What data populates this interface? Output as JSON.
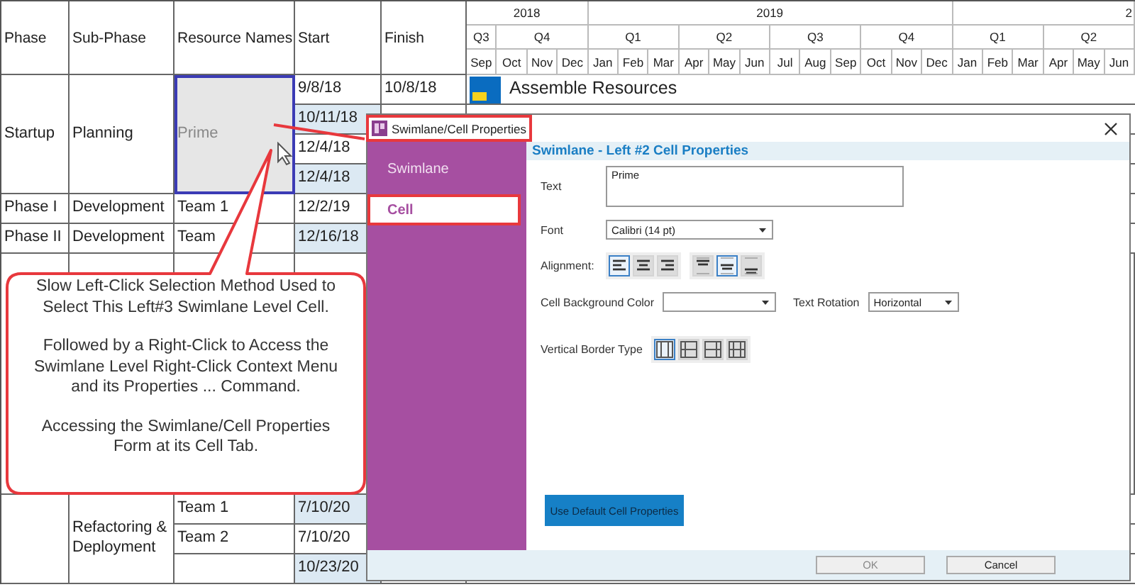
{
  "table": {
    "columns": [
      "Phase",
      "Sub-Phase",
      "Resource Names",
      "Start",
      "Finish"
    ],
    "years": [
      {
        "label": "2018",
        "quarters": [
          {
            "label": "Q3",
            "months": [
              "Sep"
            ]
          },
          {
            "label": "Q4",
            "months": [
              "Oct",
              "Nov",
              "Dec"
            ]
          }
        ]
      },
      {
        "label": "2019",
        "quarters": [
          {
            "label": "Q1",
            "months": [
              "Jan",
              "Feb",
              "Mar"
            ]
          },
          {
            "label": "Q2",
            "months": [
              "Apr",
              "May",
              "Jun"
            ]
          },
          {
            "label": "Q3",
            "months": [
              "Jul",
              "Aug",
              "Sep"
            ]
          },
          {
            "label": "Q4",
            "months": [
              "Oct",
              "Nov",
              "Dec"
            ]
          }
        ]
      },
      {
        "label": "2",
        "cut_off": true,
        "quarters": [
          {
            "label": "Q1",
            "months": [
              "Jan",
              "Feb",
              "Mar"
            ]
          },
          {
            "label": "Q2",
            "months": [
              "Apr",
              "May",
              "Jun"
            ]
          }
        ]
      }
    ],
    "groups": [
      {
        "phase": "Startup",
        "subphases": [
          {
            "name": "Planning",
            "resources": [
              {
                "name": "Prime",
                "selected": true,
                "tasks": [
                  {
                    "start": "9/8/18",
                    "finish": "10/8/18",
                    "shaded": false,
                    "bar_label": "Assemble Resources"
                  },
                  {
                    "start": "10/11/18",
                    "shaded": true
                  },
                  {
                    "start": "12/4/18",
                    "shaded": false
                  },
                  {
                    "start": "12/4/18",
                    "shaded": true
                  }
                ]
              }
            ]
          }
        ]
      },
      {
        "phase": "Phase I",
        "subphases": [
          {
            "name": "Development",
            "resources": [
              {
                "name": "Team 1",
                "selected": false,
                "tasks": [
                  {
                    "start": "12/2/19",
                    "shaded": false
                  }
                ]
              }
            ]
          }
        ]
      },
      {
        "phase": "Phase II",
        "subphases": [
          {
            "name": "Development",
            "resources": [
              {
                "name": "Team",
                "selected": false,
                "tasks": [
                  {
                    "start": "12/16/18",
                    "shaded": true
                  }
                ]
              }
            ]
          }
        ]
      },
      {
        "gap_before": true,
        "subphases": [
          {
            "name": "Refactoring & Deployment",
            "resources": [
              {
                "name": "Team 1",
                "selected": false,
                "tasks": [
                  {
                    "start": "7/10/20",
                    "shaded": true
                  }
                ]
              },
              {
                "name": "Team 2",
                "selected": false,
                "tasks": [
                  {
                    "start": "7/10/20",
                    "shaded": false
                  }
                ]
              },
              {
                "selected": false,
                "tasks": [
                  {
                    "start": "10/23/20",
                    "shaded": true
                  }
                ]
              }
            ]
          }
        ]
      }
    ]
  },
  "dialog": {
    "title": "Swimlane/Cell Properties",
    "title_highlighted": true,
    "tabs": [
      {
        "label": "Swimlane",
        "selected": false,
        "highlighted": false
      },
      {
        "label": "Cell",
        "selected": true,
        "highlighted": true
      }
    ],
    "heading": "Swimlane - Left #2 Cell Properties",
    "text_label": "Text",
    "text_value": "Prime",
    "font_label": "Font",
    "font_value": "Calibri (14 pt)",
    "alignment_label": "Alignment:",
    "horizontal_alignment": [
      {
        "kind": "left",
        "selected": true
      },
      {
        "kind": "center",
        "selected": false
      },
      {
        "kind": "right",
        "selected": false
      }
    ],
    "vertical_alignment": [
      {
        "kind": "top",
        "selected": false
      },
      {
        "kind": "middle",
        "selected": true
      },
      {
        "kind": "bottom",
        "selected": false
      }
    ],
    "background_label": "Cell Background Color",
    "rotation_label": "Text Rotation",
    "rotation_value": "Horizontal",
    "border_label": "Vertical Border Type",
    "border_types": [
      {
        "kind": "both",
        "selected": true
      },
      {
        "kind": "left",
        "selected": false
      },
      {
        "kind": "right",
        "selected": false
      },
      {
        "kind": "grid",
        "selected": false
      }
    ],
    "default_button": "Use Default Cell Properties",
    "buttons": [
      {
        "label": "OK",
        "disabled": true
      },
      {
        "label": "Cancel",
        "disabled": false
      }
    ]
  },
  "callout": {
    "paragraphs": [
      "Slow Left-Click Selection Method Used to Select This Left#3 Swimlane Level Cell.",
      "Followed by a Right-Click to Access the Swimlane Level Right-Click Context Menu and its Properties ... Command.",
      "Accessing the Swimlane/Cell Properties Form at its Cell Tab."
    ]
  }
}
